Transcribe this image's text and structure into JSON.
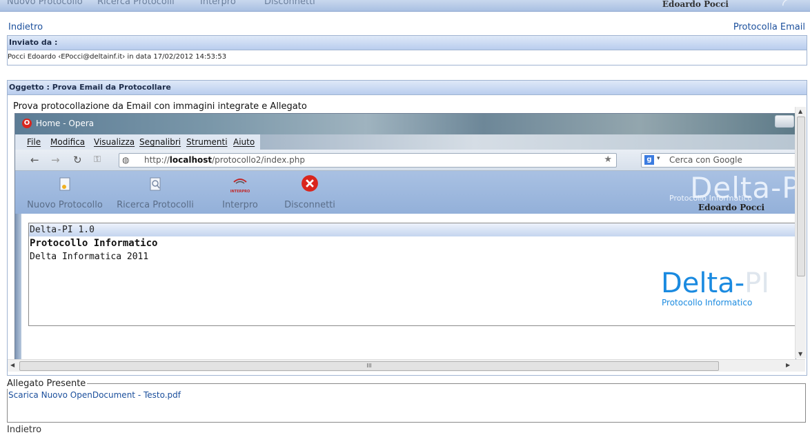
{
  "topbar": {
    "nav": [
      "Nuovo Protocollo",
      "Ricerca Protocolli",
      "Interpro",
      "Disconnetti"
    ],
    "user": "Edoardo Pocci"
  },
  "back_link": "Indietro",
  "protocol_email_link": "Protocolla Email",
  "sender_panel": {
    "header": "Inviato da :",
    "text": "Pocci Edoardo ‹EPocci@deltainf.it› in data 17/02/2012 14:53:53"
  },
  "subject_panel": {
    "header": "Oggetto : Prova Email da Protocollare",
    "body_text": "Prova protocollazione da Email con immagini integrate e Allegato"
  },
  "embedded_screenshot": {
    "window_title": "Home - Opera",
    "menu": [
      "File",
      "Modifica",
      "Visualizza",
      "Segnalibri",
      "Strumenti",
      "Aiuto"
    ],
    "url_prefix": "http://",
    "url_host": "localhost",
    "url_path": "/protocollo2/index.php",
    "search_placeholder": "Cerca con Google",
    "tools": [
      "Nuovo Protocollo",
      "Ricerca Protocolli",
      "Interpro",
      "Disconnetti"
    ],
    "interpro_icon_text": "INTERPRO",
    "app_logo": "Delta-PI",
    "app_logo_sub": "Protocollo Informatico",
    "app_user": "Edoardo Pocci",
    "panel_header": "Delta-PI 1.0",
    "panel_title": "Protocollo Informatico",
    "panel_sub": "Delta Informatica 2011",
    "big_logo_main": "Delta-",
    "big_logo_pi": "PI",
    "big_logo_sub": "Protocollo Informatico"
  },
  "scroll_grip": "III",
  "attachment": {
    "legend": "Allegato Presente",
    "link": "Scarica Nuovo OpenDocument - Testo.pdf"
  },
  "bottom_back_link": "Indietro",
  "colors": {
    "accent": "#b9cdee",
    "link": "#1b4f9c",
    "error": "#d9251d"
  }
}
